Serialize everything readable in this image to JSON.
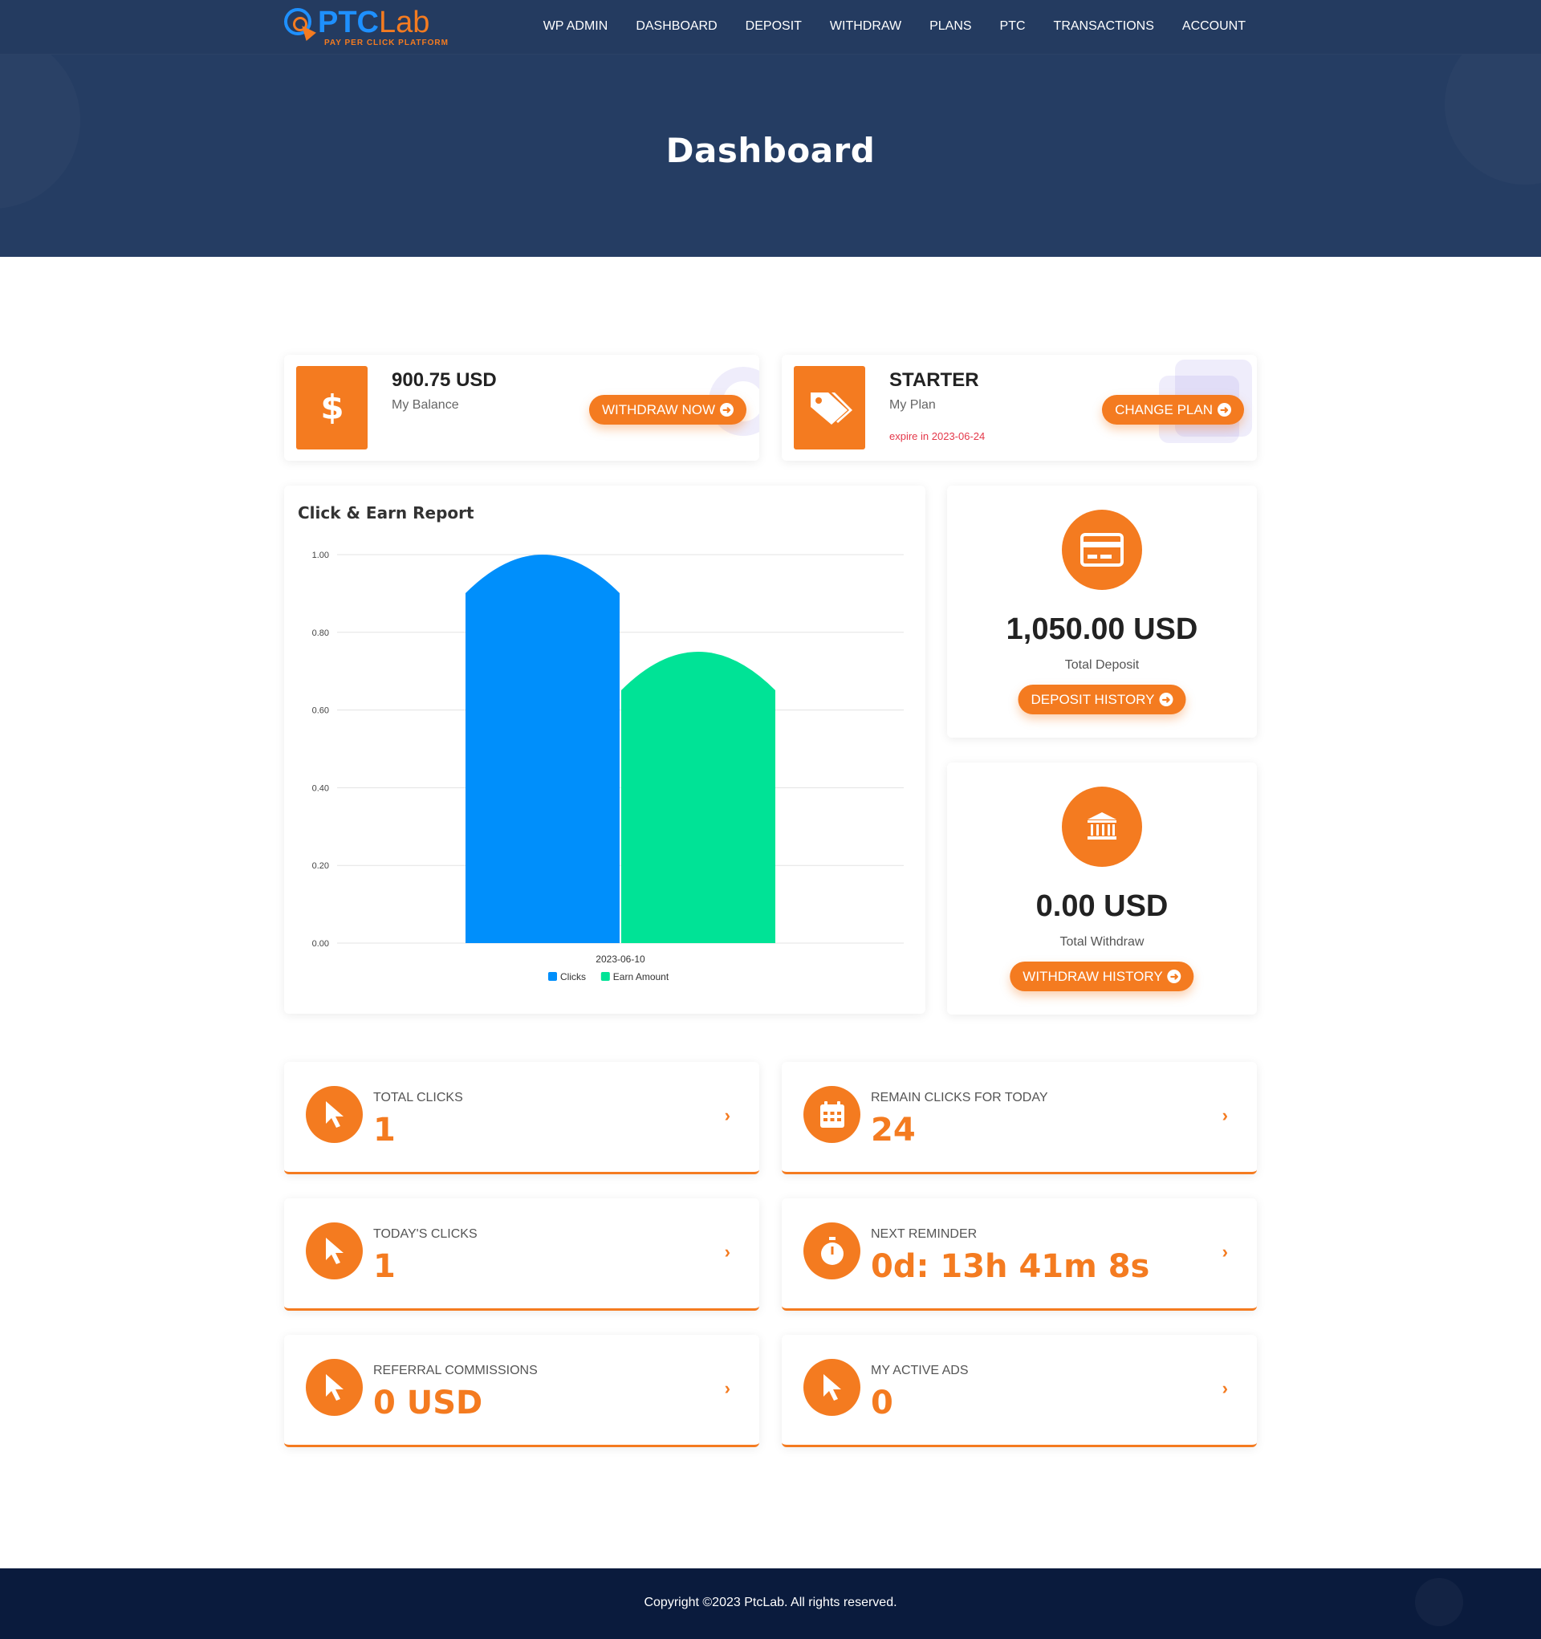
{
  "header": {
    "logo": {
      "brand_part1": "PTC",
      "brand_part2": "Lab",
      "tagline": "PAY PER CLICK PLATFORM"
    },
    "nav": [
      "WP ADMIN",
      "DASHBOARD",
      "DEPOSIT",
      "WITHDRAW",
      "PLANS",
      "PTC",
      "TRANSACTIONS",
      "ACCOUNT"
    ],
    "page_title": "Dashboard"
  },
  "balance_card": {
    "value": "900.75 USD",
    "label": "My Balance",
    "button": "WITHDRAW NOW",
    "icon": "dollar-icon"
  },
  "plan_card": {
    "value": "STARTER",
    "label": "My Plan",
    "expiry": "expire in 2023-06-24",
    "button": "CHANGE PLAN",
    "icon": "tags-icon"
  },
  "chart_card": {
    "title": "Click & Earn Report"
  },
  "chart_data": {
    "type": "bar",
    "title": "Click & Earn Report",
    "categories": [
      "2023-06-10"
    ],
    "series": [
      {
        "name": "Clicks",
        "values": [
          1
        ],
        "color": "#008ffb"
      },
      {
        "name": "Earn Amount",
        "values": [
          0.75
        ],
        "color": "#00e396"
      }
    ],
    "ylim": [
      0,
      1
    ],
    "yticks": [
      "0.00",
      "0.20",
      "0.40",
      "0.60",
      "0.80",
      "1.00"
    ],
    "grid": true,
    "legend": "bottom-center"
  },
  "deposit_card": {
    "value": "1,050.00 USD",
    "label": "Total Deposit",
    "button": "DEPOSIT HISTORY",
    "icon": "credit-card-icon"
  },
  "withdraw_card": {
    "value": "0.00 USD",
    "label": "Total Withdraw",
    "button": "WITHDRAW HISTORY",
    "icon": "bank-icon"
  },
  "info_cards": [
    {
      "label": "TOTAL CLICKS",
      "value": "1",
      "icon": "pointer-icon"
    },
    {
      "label": "REMAIN CLICKS FOR TODAY",
      "value": "24",
      "icon": "calendar-icon"
    },
    {
      "label": "TODAY'S CLICKS",
      "value": "1",
      "icon": "pointer-icon"
    },
    {
      "label": "NEXT REMINDER",
      "value": "0d: 13h 41m 8s",
      "icon": "stopwatch-icon"
    },
    {
      "label": "REFERRAL COMMISSIONS",
      "value": "0 USD",
      "icon": "pointer-icon"
    },
    {
      "label": "MY ACTIVE ADS",
      "value": "0",
      "icon": "pointer-icon"
    }
  ],
  "footer": {
    "copyright": "Copyright ©2023 PtcLab. All rights reserved."
  },
  "colors": {
    "primary": "#f47b20",
    "header_bg": "#253d63",
    "footer_bg": "#0a1b3d"
  }
}
